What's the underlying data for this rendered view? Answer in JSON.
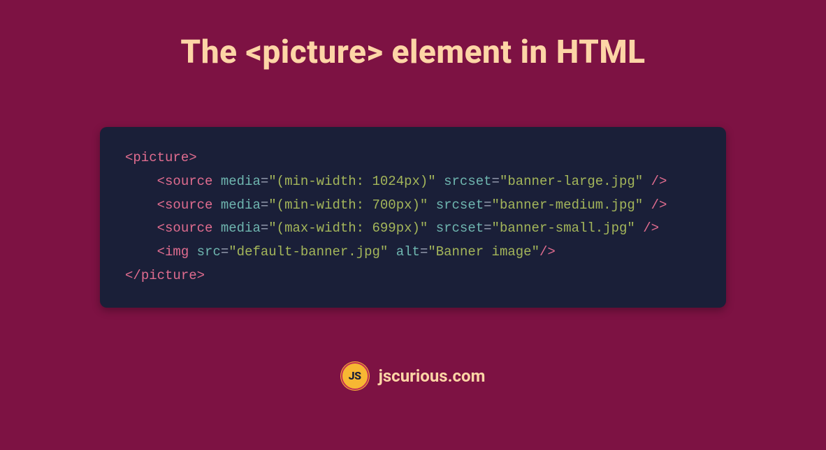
{
  "title": "The <picture> element in HTML",
  "code": {
    "lines": [
      {
        "indent": 0,
        "type": "open",
        "tag": "picture",
        "attrs": []
      },
      {
        "indent": 1,
        "type": "self",
        "tag": "source",
        "attrs": [
          {
            "name": "media",
            "value": "(min-width: 1024px)"
          },
          {
            "name": "srcset",
            "value": "banner-large.jpg"
          }
        ]
      },
      {
        "indent": 1,
        "type": "self",
        "tag": "source",
        "attrs": [
          {
            "name": "media",
            "value": "(min-width: 700px)"
          },
          {
            "name": "srcset",
            "value": "banner-medium.jpg"
          }
        ]
      },
      {
        "indent": 1,
        "type": "self",
        "tag": "source",
        "attrs": [
          {
            "name": "media",
            "value": "(max-width: 699px)"
          },
          {
            "name": "srcset",
            "value": "banner-small.jpg"
          }
        ]
      },
      {
        "indent": 1,
        "type": "self_tight",
        "tag": "img",
        "attrs": [
          {
            "name": "src",
            "value": "default-banner.jpg"
          },
          {
            "name": "alt",
            "value": "Banner image"
          }
        ]
      },
      {
        "indent": 0,
        "type": "close",
        "tag": "picture",
        "attrs": []
      }
    ]
  },
  "footer": {
    "logo_text": "JS",
    "site": "jscurious.com"
  }
}
